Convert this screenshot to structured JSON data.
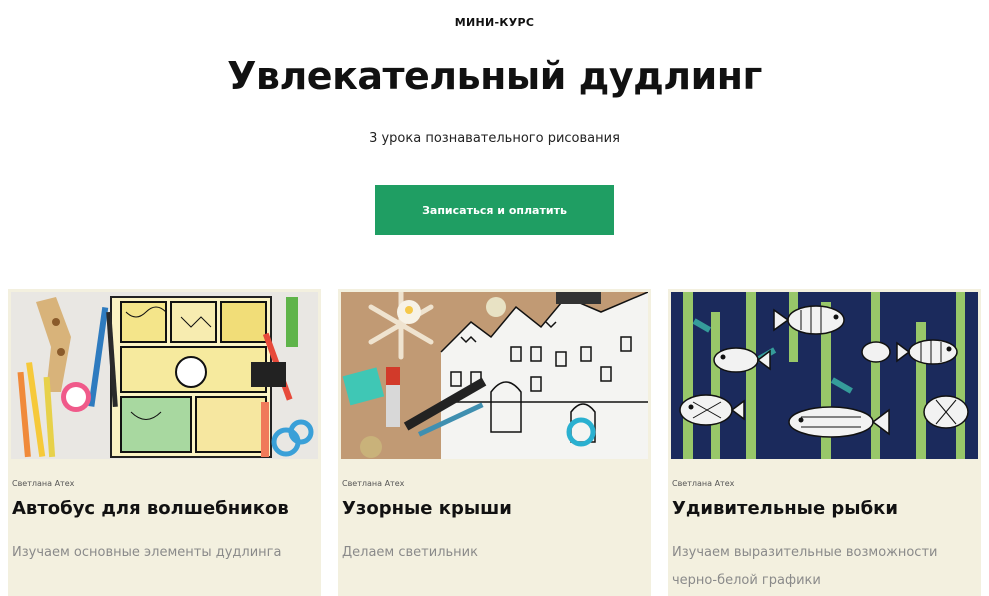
{
  "hero": {
    "eyebrow": "МИНИ-КУРС",
    "title": "Увлекательный дудлинг",
    "subtitle": "3 урока познавательного рисования",
    "cta_label": "Записаться и оплатить"
  },
  "colors": {
    "accent": "#1f9e63",
    "card_background": "#f3f0df"
  },
  "lessons": [
    {
      "author": "Светлана Атех",
      "title": "Автобус для волшебников",
      "description": "Изучаем основные элементы дудлинга"
    },
    {
      "author": "Светлана Атех",
      "title": "Узорные крыши",
      "description": "Делаем светильник"
    },
    {
      "author": "Светлана Атех",
      "title": "Удивительные рыбки",
      "description": "Изучаем выразительные возможности черно-белой графики"
    }
  ]
}
